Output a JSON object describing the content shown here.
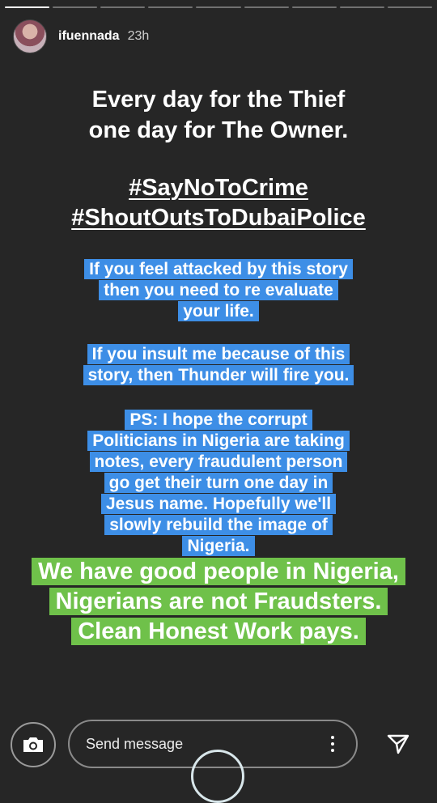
{
  "progress": {
    "total": 9,
    "current": 1
  },
  "header": {
    "username": "ifuennada",
    "time": "23h"
  },
  "story": {
    "main_lines": [
      "Every day for the Thief",
      "one day for The Owner."
    ],
    "hashtags": [
      "#SayNoToCrime",
      "#ShoutOutsToDubaiPolice"
    ],
    "blue_blocks": [
      "If you feel attacked by this story then you need to re evaluate your life.",
      "If you insult me because of this story, then Thunder will fire you.",
      "PS: I hope the corrupt Politicians in Nigeria are taking notes, every fraudulent person go get their turn one day in Jesus name. Hopefully we'll slowly rebuild the image of Nigeria."
    ],
    "green_block": "We have good people in Nigeria, Nigerians are not Fraudsters. Clean Honest Work pays."
  },
  "footer": {
    "send_placeholder": "Send message"
  },
  "colors": {
    "background": "#262626",
    "blue_highlight": "#3d8ee6",
    "green_highlight": "#6fc14a"
  },
  "icons": {
    "camera": "camera-icon",
    "more": "more-vertical-icon",
    "send": "send-icon"
  }
}
